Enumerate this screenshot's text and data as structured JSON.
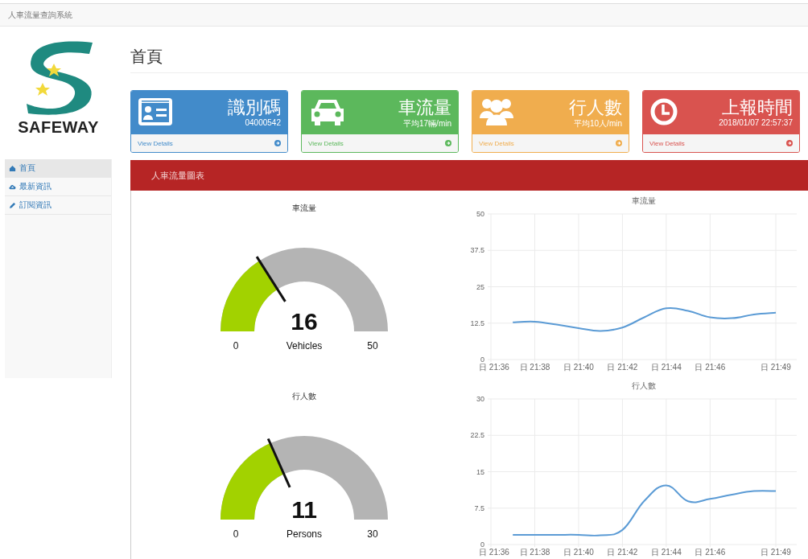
{
  "navbar": {
    "title": "人車流量查詢系統"
  },
  "logo": {
    "text": "SAFEWAY"
  },
  "sidebar": {
    "items": [
      {
        "label": "首頁",
        "selected": true
      },
      {
        "label": "最新資訊",
        "selected": false
      },
      {
        "label": "訂閱資訊",
        "selected": false
      }
    ]
  },
  "page_title": "首頁",
  "cards": [
    {
      "title": "識別碼",
      "subtitle": "04000542",
      "link": "View Details",
      "color": "#428bca"
    },
    {
      "title": "車流量",
      "subtitle": "平均17輛/min",
      "link": "View Details",
      "color": "#5cb85c"
    },
    {
      "title": "行人數",
      "subtitle": "平均10人/min",
      "link": "View Details",
      "color": "#f0ad4e"
    },
    {
      "title": "上報時間",
      "subtitle": "2018/01/07 22:57:37",
      "link": "View Details",
      "color": "#d9534f"
    }
  ],
  "panel": {
    "title": "人車流量圖表",
    "gauges": [
      {
        "title": "車流量",
        "value": "16",
        "unit": "Vehicles",
        "min": "0",
        "max": "50"
      },
      {
        "title": "行人數",
        "value": "11",
        "unit": "Persons",
        "min": "0",
        "max": "30"
      }
    ],
    "charts": [
      {
        "chart_data": {
          "type": "line",
          "title": "車流量",
          "categories": [
            "日 21:36",
            null,
            "日 21:38",
            null,
            "日 21:40",
            null,
            "日 21:42",
            null,
            "日 21:44",
            null,
            "日 21:46",
            null,
            null,
            "日 21:49"
          ],
          "series": [
            {
              "color": "#5b9bd5",
              "values": [
                null,
                12.8,
                13.0,
                12.0,
                10.8,
                9.8,
                11,
                14.5,
                17.6,
                16.7,
                14.5,
                14.2,
                15.5,
                16.1
              ]
            }
          ],
          "ylim": [
            0,
            50
          ],
          "yticks": [
            0,
            12.5,
            25,
            37.5,
            50
          ],
          "grid": true
        }
      },
      {
        "chart_data": {
          "type": "line",
          "title": "行人數",
          "categories": [
            "日 21:36",
            null,
            "日 21:38",
            null,
            "日 21:40",
            null,
            "日 21:42",
            null,
            "日 21:44",
            null,
            "日 21:46",
            null,
            null,
            "日 21:49"
          ],
          "series": [
            {
              "color": "#5b9bd5",
              "values": [
                null,
                2,
                2,
                2,
                2,
                1.9,
                3,
                9,
                12.2,
                8.9,
                9.4,
                10.3,
                11,
                11
              ]
            }
          ],
          "ylim": [
            0,
            30
          ],
          "yticks": [
            0,
            7.5,
            15,
            22.5,
            30
          ],
          "grid": true
        }
      }
    ]
  }
}
